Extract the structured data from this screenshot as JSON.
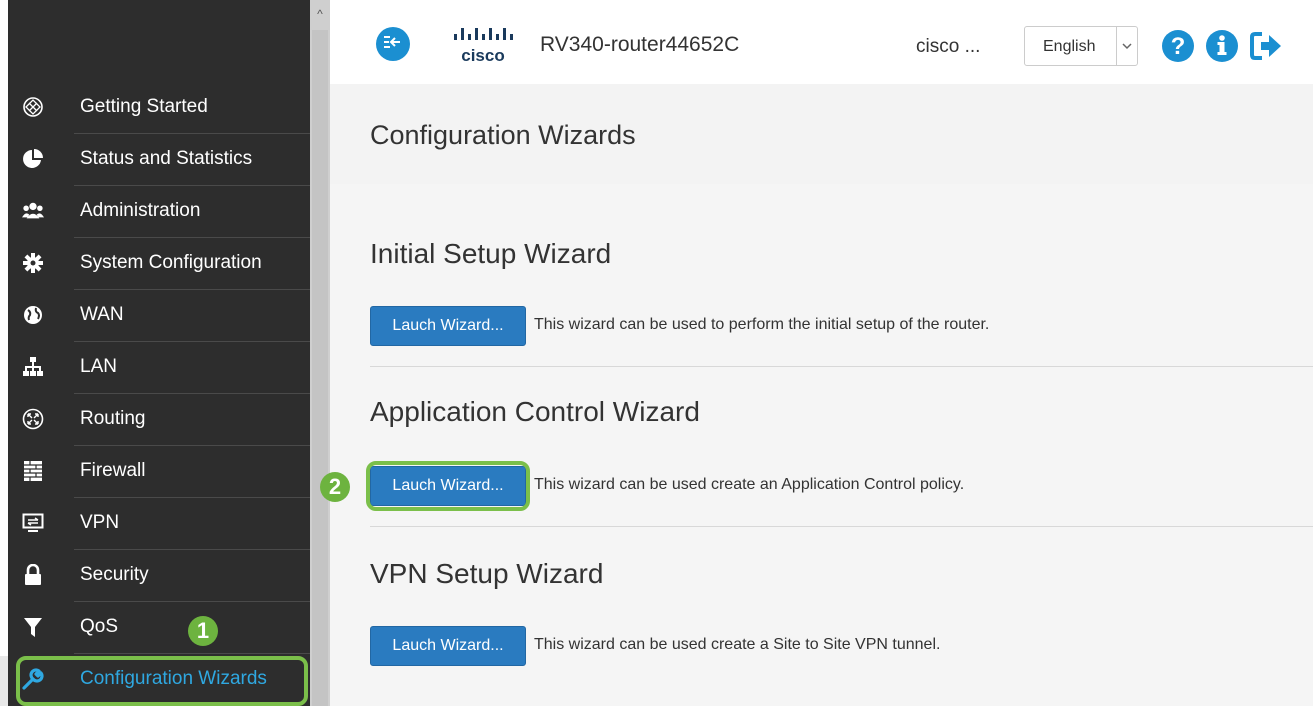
{
  "sidebar": {
    "items": [
      {
        "label": "Getting Started",
        "icon": "getting-started-icon"
      },
      {
        "label": "Status and Statistics",
        "icon": "pie-chart-icon"
      },
      {
        "label": "Administration",
        "icon": "users-icon"
      },
      {
        "label": "System Configuration",
        "icon": "gear-icon"
      },
      {
        "label": "WAN",
        "icon": "globe-icon"
      },
      {
        "label": "LAN",
        "icon": "network-icon"
      },
      {
        "label": "Routing",
        "icon": "routing-icon"
      },
      {
        "label": "Firewall",
        "icon": "firewall-icon"
      },
      {
        "label": "VPN",
        "icon": "vpn-icon"
      },
      {
        "label": "Security",
        "icon": "lock-icon"
      },
      {
        "label": "QoS",
        "icon": "filter-icon"
      },
      {
        "label": "Configuration Wizards",
        "icon": "wrench-icon",
        "active": true
      }
    ]
  },
  "header": {
    "brand": "cisco",
    "device_name": "RV340-router44652C",
    "user_name": "cisco ...",
    "language": "English"
  },
  "page": {
    "title": "Configuration Wizards"
  },
  "sections": [
    {
      "title": "Initial Setup Wizard",
      "button_label": "Lauch Wizard...",
      "description": "This wizard can be used to perform the initial setup of the router."
    },
    {
      "title": "Application Control Wizard",
      "button_label": "Lauch Wizard...",
      "description": "This wizard can be used create an Application Control policy."
    },
    {
      "title": "VPN Setup Wizard",
      "button_label": "Lauch Wizard...",
      "description": "This wizard can be used create a Site to Site VPN tunnel."
    }
  ],
  "callouts": [
    {
      "number": "1"
    },
    {
      "number": "2"
    }
  ],
  "colors": {
    "sidebar_bg": "#2d2d2d",
    "accent": "#1b8fd1",
    "button": "#2a7bc0",
    "callout": "#6db33f"
  }
}
